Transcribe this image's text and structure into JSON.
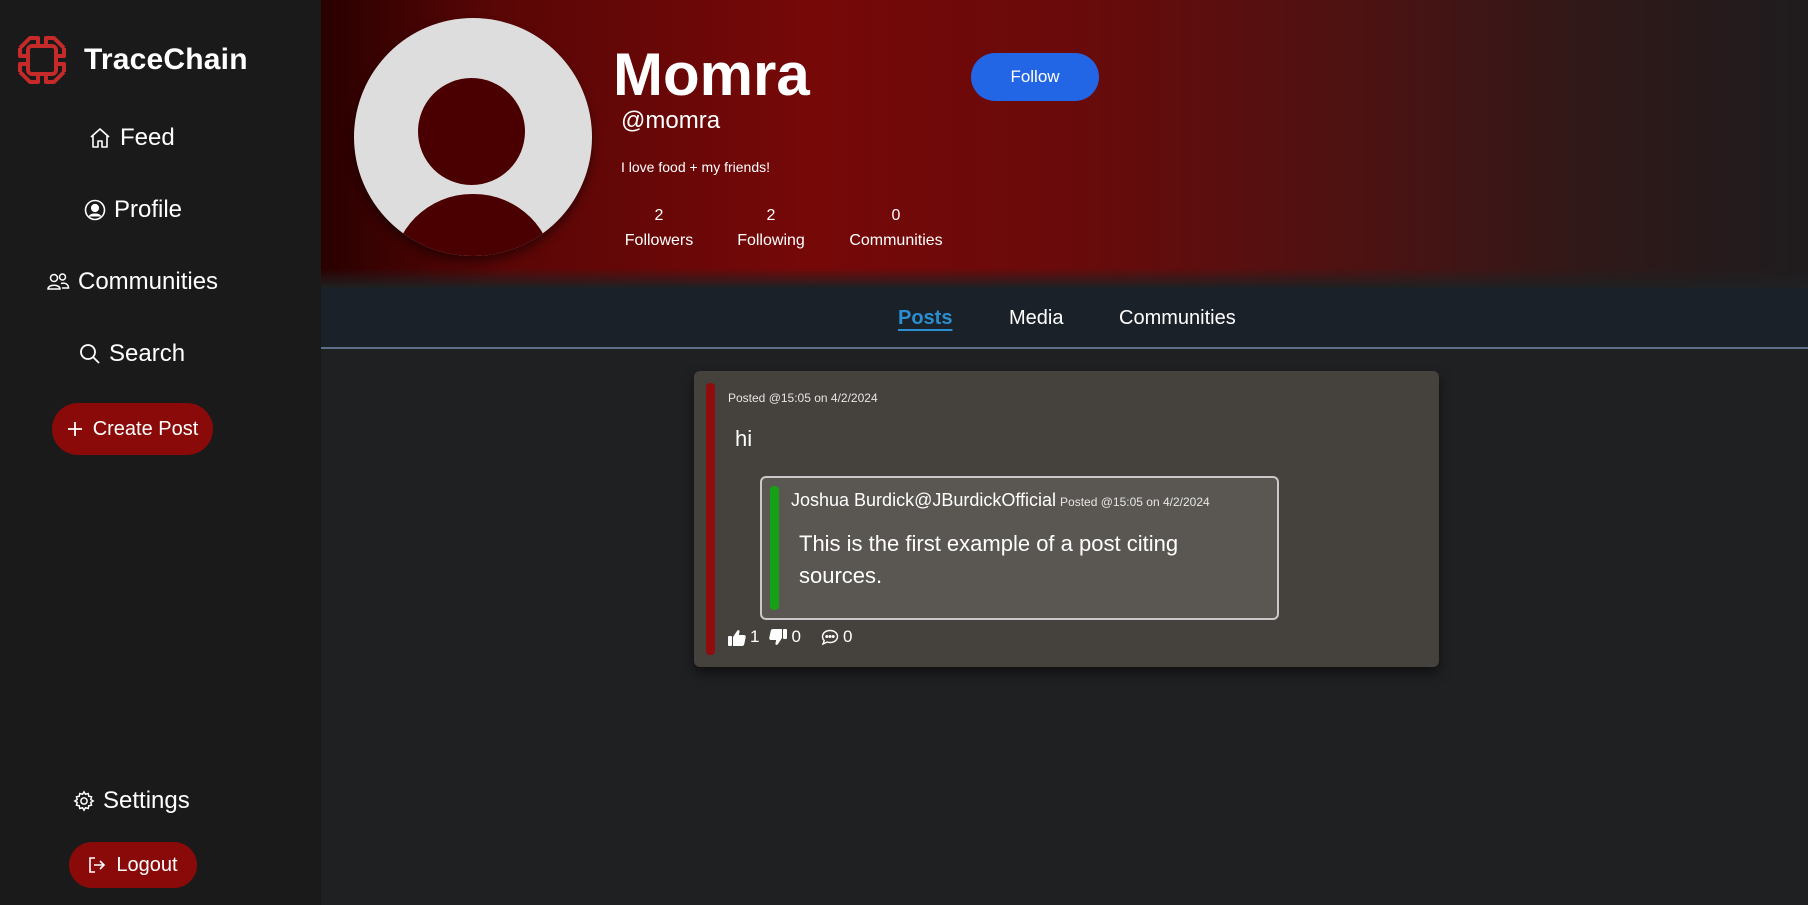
{
  "brand": {
    "name": "TraceChain",
    "logo_icon": "tracechain-logo-icon",
    "color": "#c42a2a"
  },
  "nav": {
    "feed": "Feed",
    "profile": "Profile",
    "communities": "Communities",
    "search": "Search",
    "create_post": "Create Post",
    "settings": "Settings",
    "logout": "Logout"
  },
  "profile": {
    "display_name": "Momra",
    "handle": "@momra",
    "bio": "I love food + my friends!",
    "follow_label": "Follow",
    "stats": [
      {
        "value": "2",
        "label": "Followers"
      },
      {
        "value": "2",
        "label": "Following"
      },
      {
        "value": "0",
        "label": "Communities"
      }
    ]
  },
  "tabs": [
    {
      "label": "Posts",
      "active": true
    },
    {
      "label": "Media",
      "active": false
    },
    {
      "label": "Communities",
      "active": false
    }
  ],
  "post": {
    "meta": "Posted @15:05 on 4/2/2024",
    "text": "hi",
    "quote": {
      "author": "Joshua Burdick@JBurdickOfficial",
      "meta": "Posted @15:05 on 4/2/2024",
      "text": "This is the first example of a post citing sources."
    },
    "likes": "1",
    "dislikes": "0",
    "comments": "0"
  },
  "colors": {
    "accent_red": "#8a0a0a",
    "follow_blue": "#2266e6",
    "active_tab": "#2a8fd0",
    "quote_bar": "#15a015"
  }
}
